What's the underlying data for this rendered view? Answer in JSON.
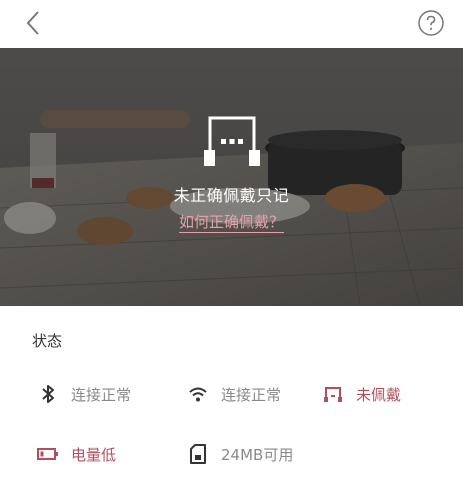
{
  "header": {
    "back_icon": "chevron-left-icon",
    "help_icon": "question-circle-icon"
  },
  "hero": {
    "title": "未正确佩戴只记",
    "link": "如何正确佩戴？",
    "icon": "headband-icon"
  },
  "status": {
    "label": "状态",
    "items": [
      {
        "icon": "bluetooth-icon",
        "text": "连接正常",
        "state": "normal"
      },
      {
        "icon": "wifi-icon",
        "text": "连接正常",
        "state": "normal"
      },
      {
        "icon": "headband-icon",
        "text": "未佩戴",
        "state": "warning"
      },
      {
        "icon": "battery-low-icon",
        "text": "电量低",
        "state": "warning"
      },
      {
        "icon": "sd-card-icon",
        "text": "24MB可用",
        "state": "normal"
      }
    ]
  },
  "colors": {
    "warning": "#b0505a",
    "link": "#e8a0a8",
    "normal_text": "#8a8a8a"
  }
}
